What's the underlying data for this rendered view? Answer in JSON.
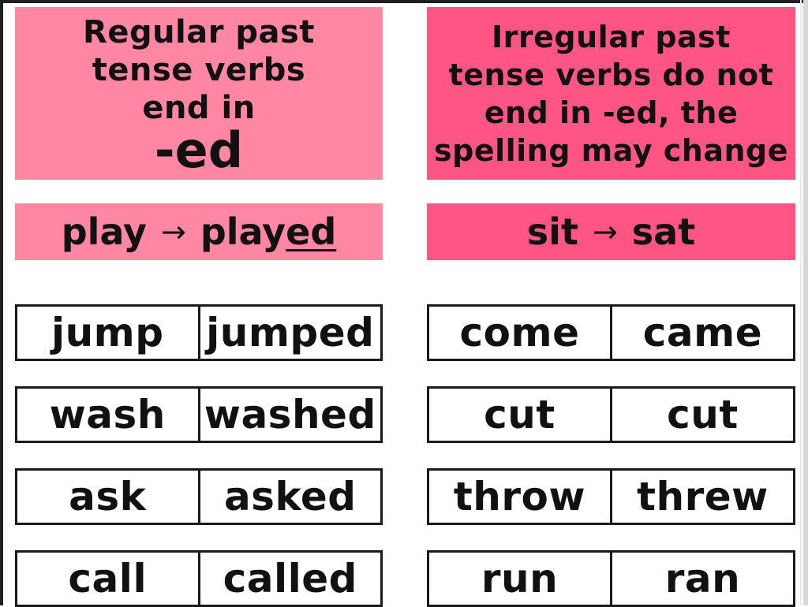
{
  "colors": {
    "regular_pink": "#ff87a3",
    "irregular_pink": "#ff5584",
    "border": "#1a1a1a"
  },
  "regular": {
    "rule_lines": [
      "Regular past",
      "tense verbs",
      "end in"
    ],
    "rule_emphasis": "-ed",
    "example": {
      "base": "play",
      "arrow": "→",
      "past_stem": "play",
      "past_suffix": "ed"
    },
    "pairs": [
      {
        "present": "jump",
        "past": "jumped"
      },
      {
        "present": "wash",
        "past": "washed"
      },
      {
        "present": "ask",
        "past": "asked"
      },
      {
        "present": "call",
        "past": "called"
      }
    ]
  },
  "irregular": {
    "rule_lines": [
      "Irregular past",
      "tense verbs do not",
      "end in -ed, the",
      "spelling may change"
    ],
    "example": {
      "base": "sit",
      "arrow": "→",
      "past": "sat"
    },
    "pairs": [
      {
        "present": "come",
        "past": "came"
      },
      {
        "present": "cut",
        "past": "cut"
      },
      {
        "present": "throw",
        "past": "threw"
      },
      {
        "present": "run",
        "past": "ran"
      }
    ]
  }
}
